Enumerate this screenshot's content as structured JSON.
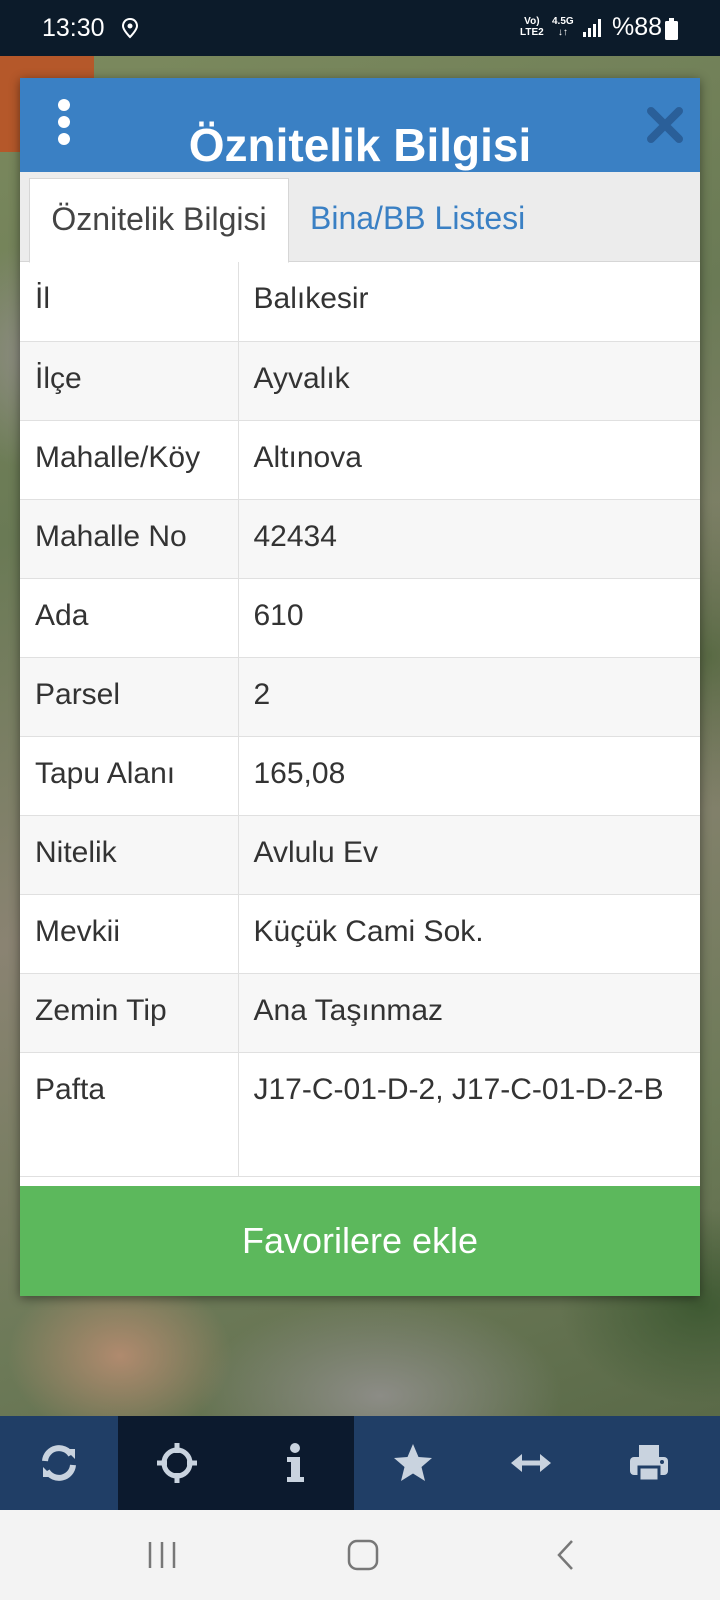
{
  "status_bar": {
    "time": "13:30",
    "net_top": "Vo)",
    "net_bottom": "LTE2",
    "net2_top": "4.5G",
    "net2_bottom": "↓↑",
    "battery_text": "%88"
  },
  "dialog": {
    "title": "Öznitelik Bilgisi",
    "tabs": [
      {
        "label": "Öznitelik Bilgisi",
        "active": true
      },
      {
        "label": "Bina/BB Listesi",
        "active": false
      }
    ],
    "rows": [
      {
        "key": "İl",
        "value": "Balıkesir"
      },
      {
        "key": "İlçe",
        "value": "Ayvalık"
      },
      {
        "key": "Mahalle/Köy",
        "value": "Altınova"
      },
      {
        "key": "Mahalle No",
        "value": "42434"
      },
      {
        "key": "Ada",
        "value": "610"
      },
      {
        "key": "Parsel",
        "value": "2"
      },
      {
        "key": "Tapu Alanı",
        "value": "165,08"
      },
      {
        "key": "Nitelik",
        "value": "Avlulu Ev"
      },
      {
        "key": "Mevkii",
        "value": "Küçük Cami Sok."
      },
      {
        "key": "Zemin Tip",
        "value": "Ana Taşınmaz"
      },
      {
        "key": "Pafta",
        "value": "J17-C-01-D-2,   J17-C-01-D-2-B"
      }
    ],
    "favorite_button": "Favorilere ekle"
  },
  "toolbar": {
    "icons": [
      "refresh-icon",
      "crosshair-icon",
      "info-icon",
      "star-icon",
      "measure-icon",
      "print-icon"
    ],
    "active_index": 2
  },
  "colors": {
    "header_blue": "#3a80c4",
    "toolbar_blue": "#203e66",
    "button_green": "#5cb85c"
  }
}
